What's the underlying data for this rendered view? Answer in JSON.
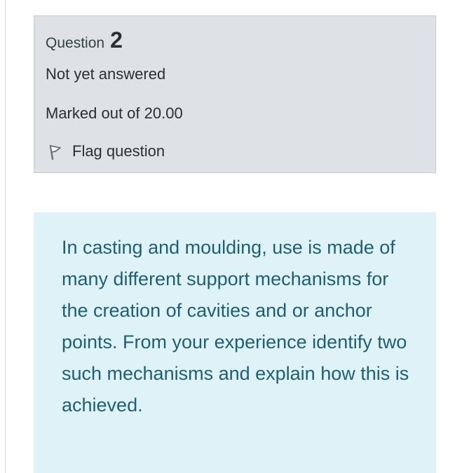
{
  "info": {
    "question_label": "Question",
    "question_number": "2",
    "status": "Not yet answered",
    "marks": "Marked out of 20.00",
    "flag_label": "Flag question"
  },
  "question": {
    "text": "In casting and moulding, use is made of many different support mechanisms for the creation of cavities and or anchor points. From your experience identify two such mechanisms and explain how this is achieved."
  },
  "colors": {
    "info_background": "#dee2e6",
    "question_background": "#def2f8",
    "question_text": "#1e5f78"
  },
  "icons": {
    "flag": "flag-icon"
  }
}
